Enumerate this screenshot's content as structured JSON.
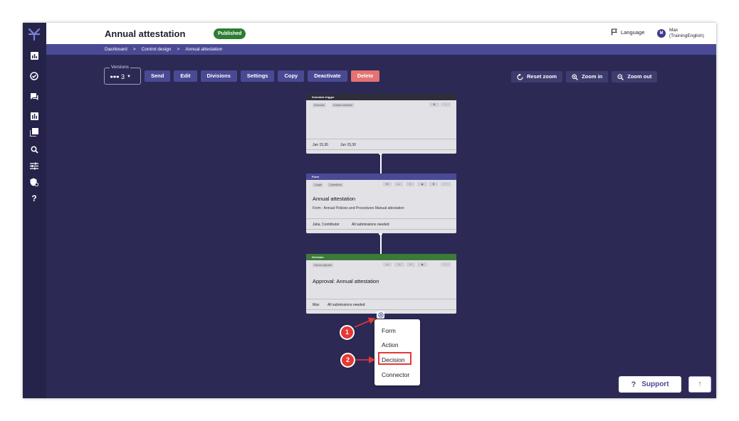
{
  "header": {
    "title": "Annual attestation",
    "status_badge": "Published",
    "language_label": "Language",
    "user": {
      "avatar_initial": "M",
      "name": "Max",
      "subtitle": "(TrainingEnglish)"
    }
  },
  "breadcrumb": {
    "items": [
      "Dashboard",
      "Control design",
      "Annual attestation"
    ],
    "separator": ">"
  },
  "toolbar": {
    "versions_label": "Versions",
    "versions_value": "3",
    "buttons": [
      "Send",
      "Edit",
      "Divisions",
      "Settings",
      "Copy",
      "Deactivate",
      "Delete"
    ]
  },
  "zoom": {
    "reset": "Reset zoom",
    "zoom_in": "Zoom in",
    "zoom_out": "Zoom out"
  },
  "nodes": {
    "schedule": {
      "header": "Schedule trigger",
      "chips": [
        "Schedule",
        "Custom schedule"
      ],
      "footer_dates": [
        "Jan 15,30",
        "Jun 15,30"
      ]
    },
    "form": {
      "header": "Form",
      "chips": [
        "1 page",
        "2 questions"
      ],
      "title": "Annual attestation",
      "subtitle": "Form : Annual Policies and Procedures Manual attestation",
      "footer": "Julia, Contributor",
      "footer_status": "All submissions needed"
    },
    "decision": {
      "header": "Decision",
      "chips": [
        "Can be rejected"
      ],
      "title": "Approval: Annual attestation",
      "footer": "Max",
      "footer_status": "All submissions needed"
    }
  },
  "add_menu": {
    "items": [
      "Form",
      "Action",
      "Decision",
      "Connector"
    ]
  },
  "markers": [
    "1",
    "2"
  ],
  "support": {
    "label": "Support"
  },
  "colors": {
    "canvas": "#2c2a55",
    "primary": "#4a4a94",
    "danger": "#e57373",
    "published": "#2e7d32",
    "decision_header": "#3c7a3a",
    "schedule_header": "#2e2e3a",
    "marker": "#e53935"
  }
}
